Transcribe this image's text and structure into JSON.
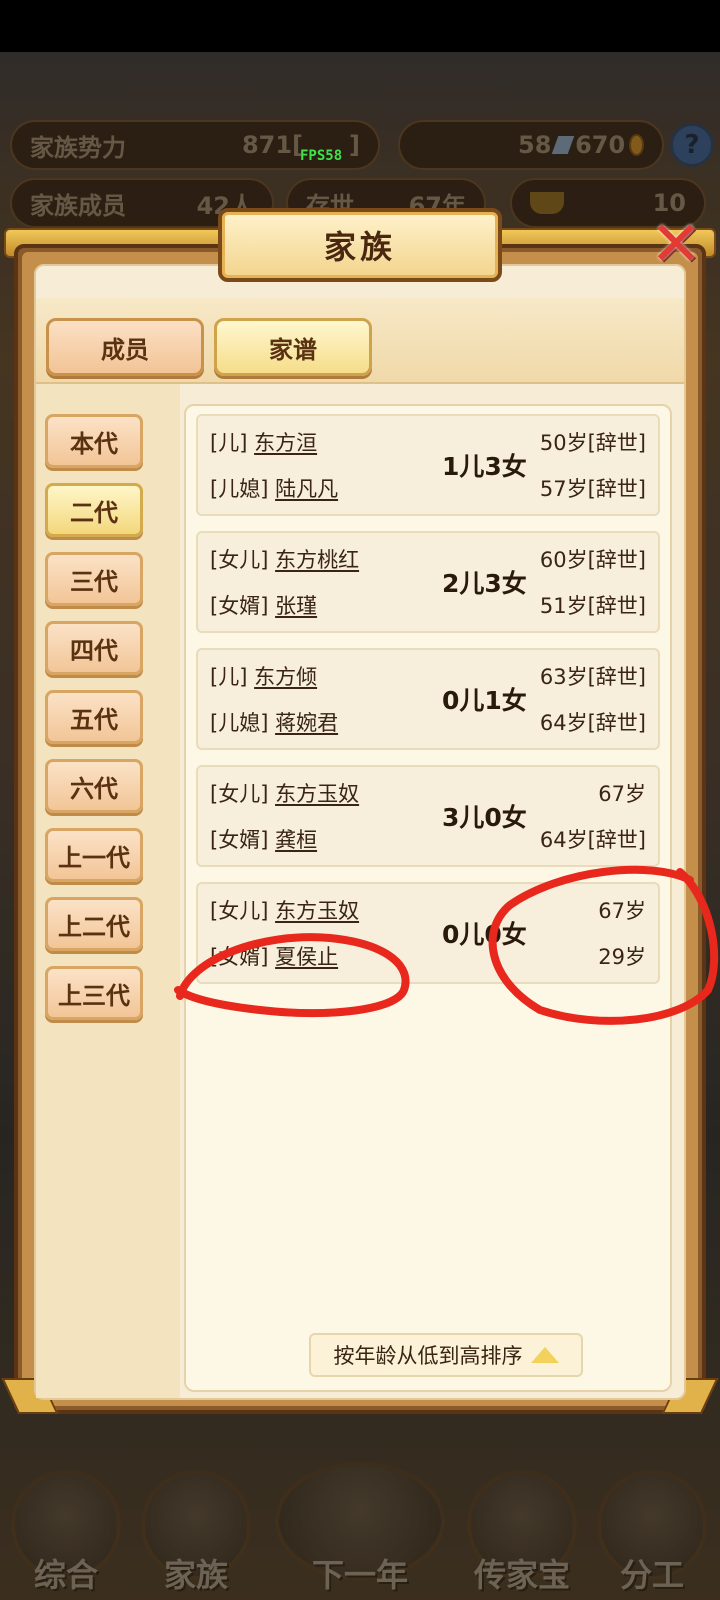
{
  "hud": {
    "clan_power_label": "家族势力",
    "clan_power_value": "871[",
    "clan_power_suffix": "]",
    "fps": "FPS58",
    "books": "58",
    "coins": "670",
    "help": "?",
    "members_label": "家族成员",
    "members_value": "42人",
    "exist_label": "存世",
    "exist_value": "67年",
    "gold": "10"
  },
  "modal": {
    "title": "家族",
    "close_symbol": "✕",
    "tabs": [
      {
        "label": "成员",
        "active": false
      },
      {
        "label": "家谱",
        "active": true
      }
    ],
    "generations": [
      {
        "label": "本代",
        "active": false
      },
      {
        "label": "二代",
        "active": true
      },
      {
        "label": "三代",
        "active": false
      },
      {
        "label": "四代",
        "active": false
      },
      {
        "label": "五代",
        "active": false
      },
      {
        "label": "六代",
        "active": false
      },
      {
        "label": "上一代",
        "active": false
      },
      {
        "label": "上二代",
        "active": false
      },
      {
        "label": "上三代",
        "active": false
      }
    ],
    "couples": [
      {
        "p1_role": "[儿]",
        "p1_name": "东方洹",
        "p2_role": "[儿媳]",
        "p2_name": "陆凡凡",
        "children": "1儿3女",
        "p1_age": "50岁[辞世]",
        "p2_age": "57岁[辞世]"
      },
      {
        "p1_role": "[女儿]",
        "p1_name": "东方桃红",
        "p2_role": "[女婿]",
        "p2_name": "张瑾",
        "children": "2儿3女",
        "p1_age": "60岁[辞世]",
        "p2_age": "51岁[辞世]"
      },
      {
        "p1_role": "[儿]",
        "p1_name": "东方倾",
        "p2_role": "[儿媳]",
        "p2_name": "蒋婉君",
        "children": "0儿1女",
        "p1_age": "63岁[辞世]",
        "p2_age": "64岁[辞世]"
      },
      {
        "p1_role": "[女儿]",
        "p1_name": "东方玉奴",
        "p2_role": "[女婿]",
        "p2_name": "龚桓",
        "children": "3儿0女",
        "p1_age": "67岁",
        "p2_age": "64岁[辞世]"
      },
      {
        "p1_role": "[女儿]",
        "p1_name": "东方玉奴",
        "p2_role": "[女婿]",
        "p2_name": "夏侯止",
        "children": "0儿0女",
        "p1_age": "67岁",
        "p2_age": "29岁"
      }
    ],
    "sort_label": "按年龄从低到高排序"
  },
  "bottom_nav": [
    {
      "label": "综合"
    },
    {
      "label": "家族"
    },
    {
      "label": "下一年"
    },
    {
      "label": "传家宝"
    },
    {
      "label": "分工"
    }
  ],
  "colors": {
    "annotation_red": "#e8281c",
    "panel_cream": "#f7edd6",
    "frame_gold": "#c48f4a"
  }
}
